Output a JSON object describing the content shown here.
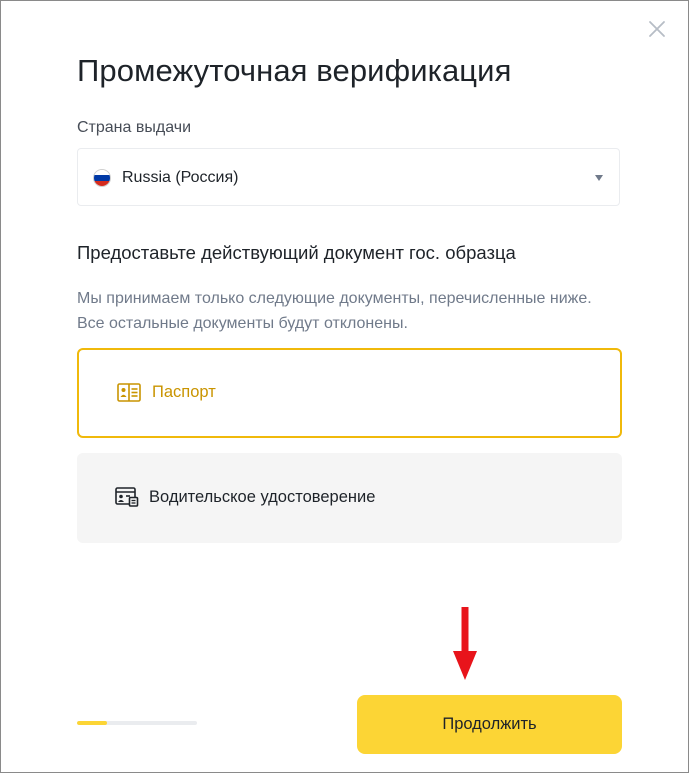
{
  "dialog": {
    "title": "Промежуточная верификация",
    "close_icon": "close-icon"
  },
  "country": {
    "label": "Страна выдачи",
    "value": "Russia (Россия)",
    "flag_icon": "russia-flag-icon",
    "caret_icon": "caret-down-icon"
  },
  "documents": {
    "heading": "Предоставьте действующий документ гос. образца",
    "description": "Мы принимаем только следующие документы, перечисленные ниже. Все остальные документы будут отклонены.",
    "options": [
      {
        "label": "Паспорт",
        "icon": "passport-icon",
        "selected": true
      },
      {
        "label": "Водительское удостоверение",
        "icon": "driver-license-icon",
        "selected": false
      }
    ]
  },
  "footer": {
    "progress_fraction": 0.25,
    "continue_label": "Продолжить"
  },
  "colors": {
    "accent": "#fcd535",
    "selected_border": "#f0b90b",
    "selected_text": "#c99400",
    "annotation_arrow": "#e8141b"
  }
}
